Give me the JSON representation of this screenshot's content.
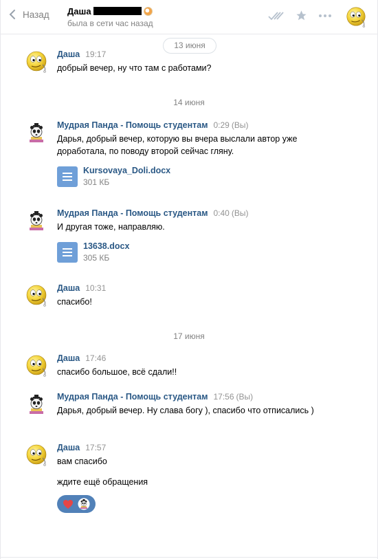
{
  "header": {
    "back_label": "Назад",
    "contact_name": "Даша",
    "status": "была в сети час назад"
  },
  "dates": [
    "13 июня",
    "14 июня",
    "17 июня"
  ],
  "messages": [
    {
      "author": "Даша",
      "time": "19:17",
      "text": "добрый вечер, ну что там с работами?"
    },
    {
      "author": "Мудрая Панда - Помощь студентам",
      "time": "0:29",
      "you": "(Вы)",
      "text": "Дарья, добрый вечер, которую вы вчера выслали автор уже доработала, по поводу второй сейчас гляну.",
      "doc": {
        "name": "Kursovaya_Doli.docx",
        "size": "301 КБ"
      }
    },
    {
      "author": "Мудрая Панда - Помощь студентам",
      "time": "0:40",
      "you": "(Вы)",
      "text": "И другая тоже, направляю.",
      "doc": {
        "name": "13638.docx",
        "size": "305 КБ"
      }
    },
    {
      "author": "Даша",
      "time": "10:31",
      "text": "спасибо!"
    },
    {
      "author": "Даша",
      "time": "17:46",
      "text": "спасибо большое, всё сдали!!"
    },
    {
      "author": "Мудрая Панда - Помощь студентам",
      "time": "17:56",
      "you": "(Вы)",
      "text": "Дарья, добрый вечер. Ну слава богу ), спасибо что отписались )"
    },
    {
      "author": "Даша",
      "time": "17:57",
      "text": "вам спасибо",
      "text2": "ждите ещё обращения"
    }
  ],
  "icons": {
    "back": "chevron-left-icon",
    "read": "double-check-icon",
    "favorite": "star-icon",
    "more": "more-icon",
    "reaction_1": "heart-icon",
    "reaction_2": "panda-icon"
  },
  "colors": {
    "link": "#2a5885",
    "meta": "#828282",
    "doc": "#6f9fd8",
    "reactions": "#5181b8"
  }
}
